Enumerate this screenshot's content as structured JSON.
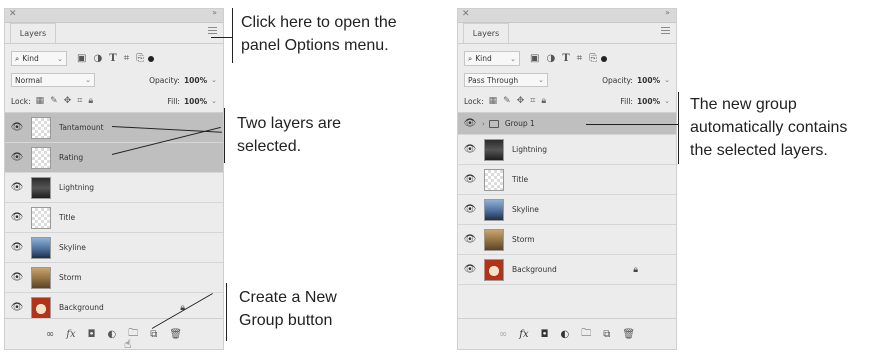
{
  "left_panel": {
    "tab": "Layers",
    "filter_label": "Kind",
    "blend_mode": "Normal",
    "opacity_label": "Opacity:",
    "opacity_value": "100%",
    "lock_label": "Lock:",
    "fill_label": "Fill:",
    "fill_value": "100%",
    "layers": [
      {
        "name": "Tantamount",
        "selected": true
      },
      {
        "name": "Rating",
        "selected": true
      },
      {
        "name": "Lightning",
        "selected": false
      },
      {
        "name": "Title",
        "selected": false
      },
      {
        "name": "Skyline",
        "selected": false
      },
      {
        "name": "Storm",
        "selected": false
      },
      {
        "name": "Background",
        "selected": false,
        "locked": true
      }
    ]
  },
  "right_panel": {
    "tab": "Layers",
    "filter_label": "Kind",
    "blend_mode": "Pass Through",
    "opacity_label": "Opacity:",
    "opacity_value": "100%",
    "lock_label": "Lock:",
    "fill_label": "Fill:",
    "fill_value": "100%",
    "layers": [
      {
        "name": "Group 1",
        "selected": true,
        "group": true
      },
      {
        "name": "Lightning",
        "selected": false
      },
      {
        "name": "Title",
        "selected": false
      },
      {
        "name": "Skyline",
        "selected": false
      },
      {
        "name": "Storm",
        "selected": false
      },
      {
        "name": "Background",
        "selected": false,
        "locked": true
      }
    ]
  },
  "callouts": {
    "options_menu_line1": "Click here to open the",
    "options_menu_line2": "panel Options menu.",
    "selected_line1": "Two layers are",
    "selected_line2": "selected.",
    "new_group_line1": "Create a New",
    "new_group_line2": "Group button",
    "group_contains_line1": "The new group",
    "group_contains_line2": "automatically contains",
    "group_contains_line3": "the selected layers."
  },
  "icons": {
    "visibility": "eye-icon",
    "panel_menu": "panel-menu-icon",
    "lock": "lock-icon",
    "new_group": "folder-icon"
  }
}
